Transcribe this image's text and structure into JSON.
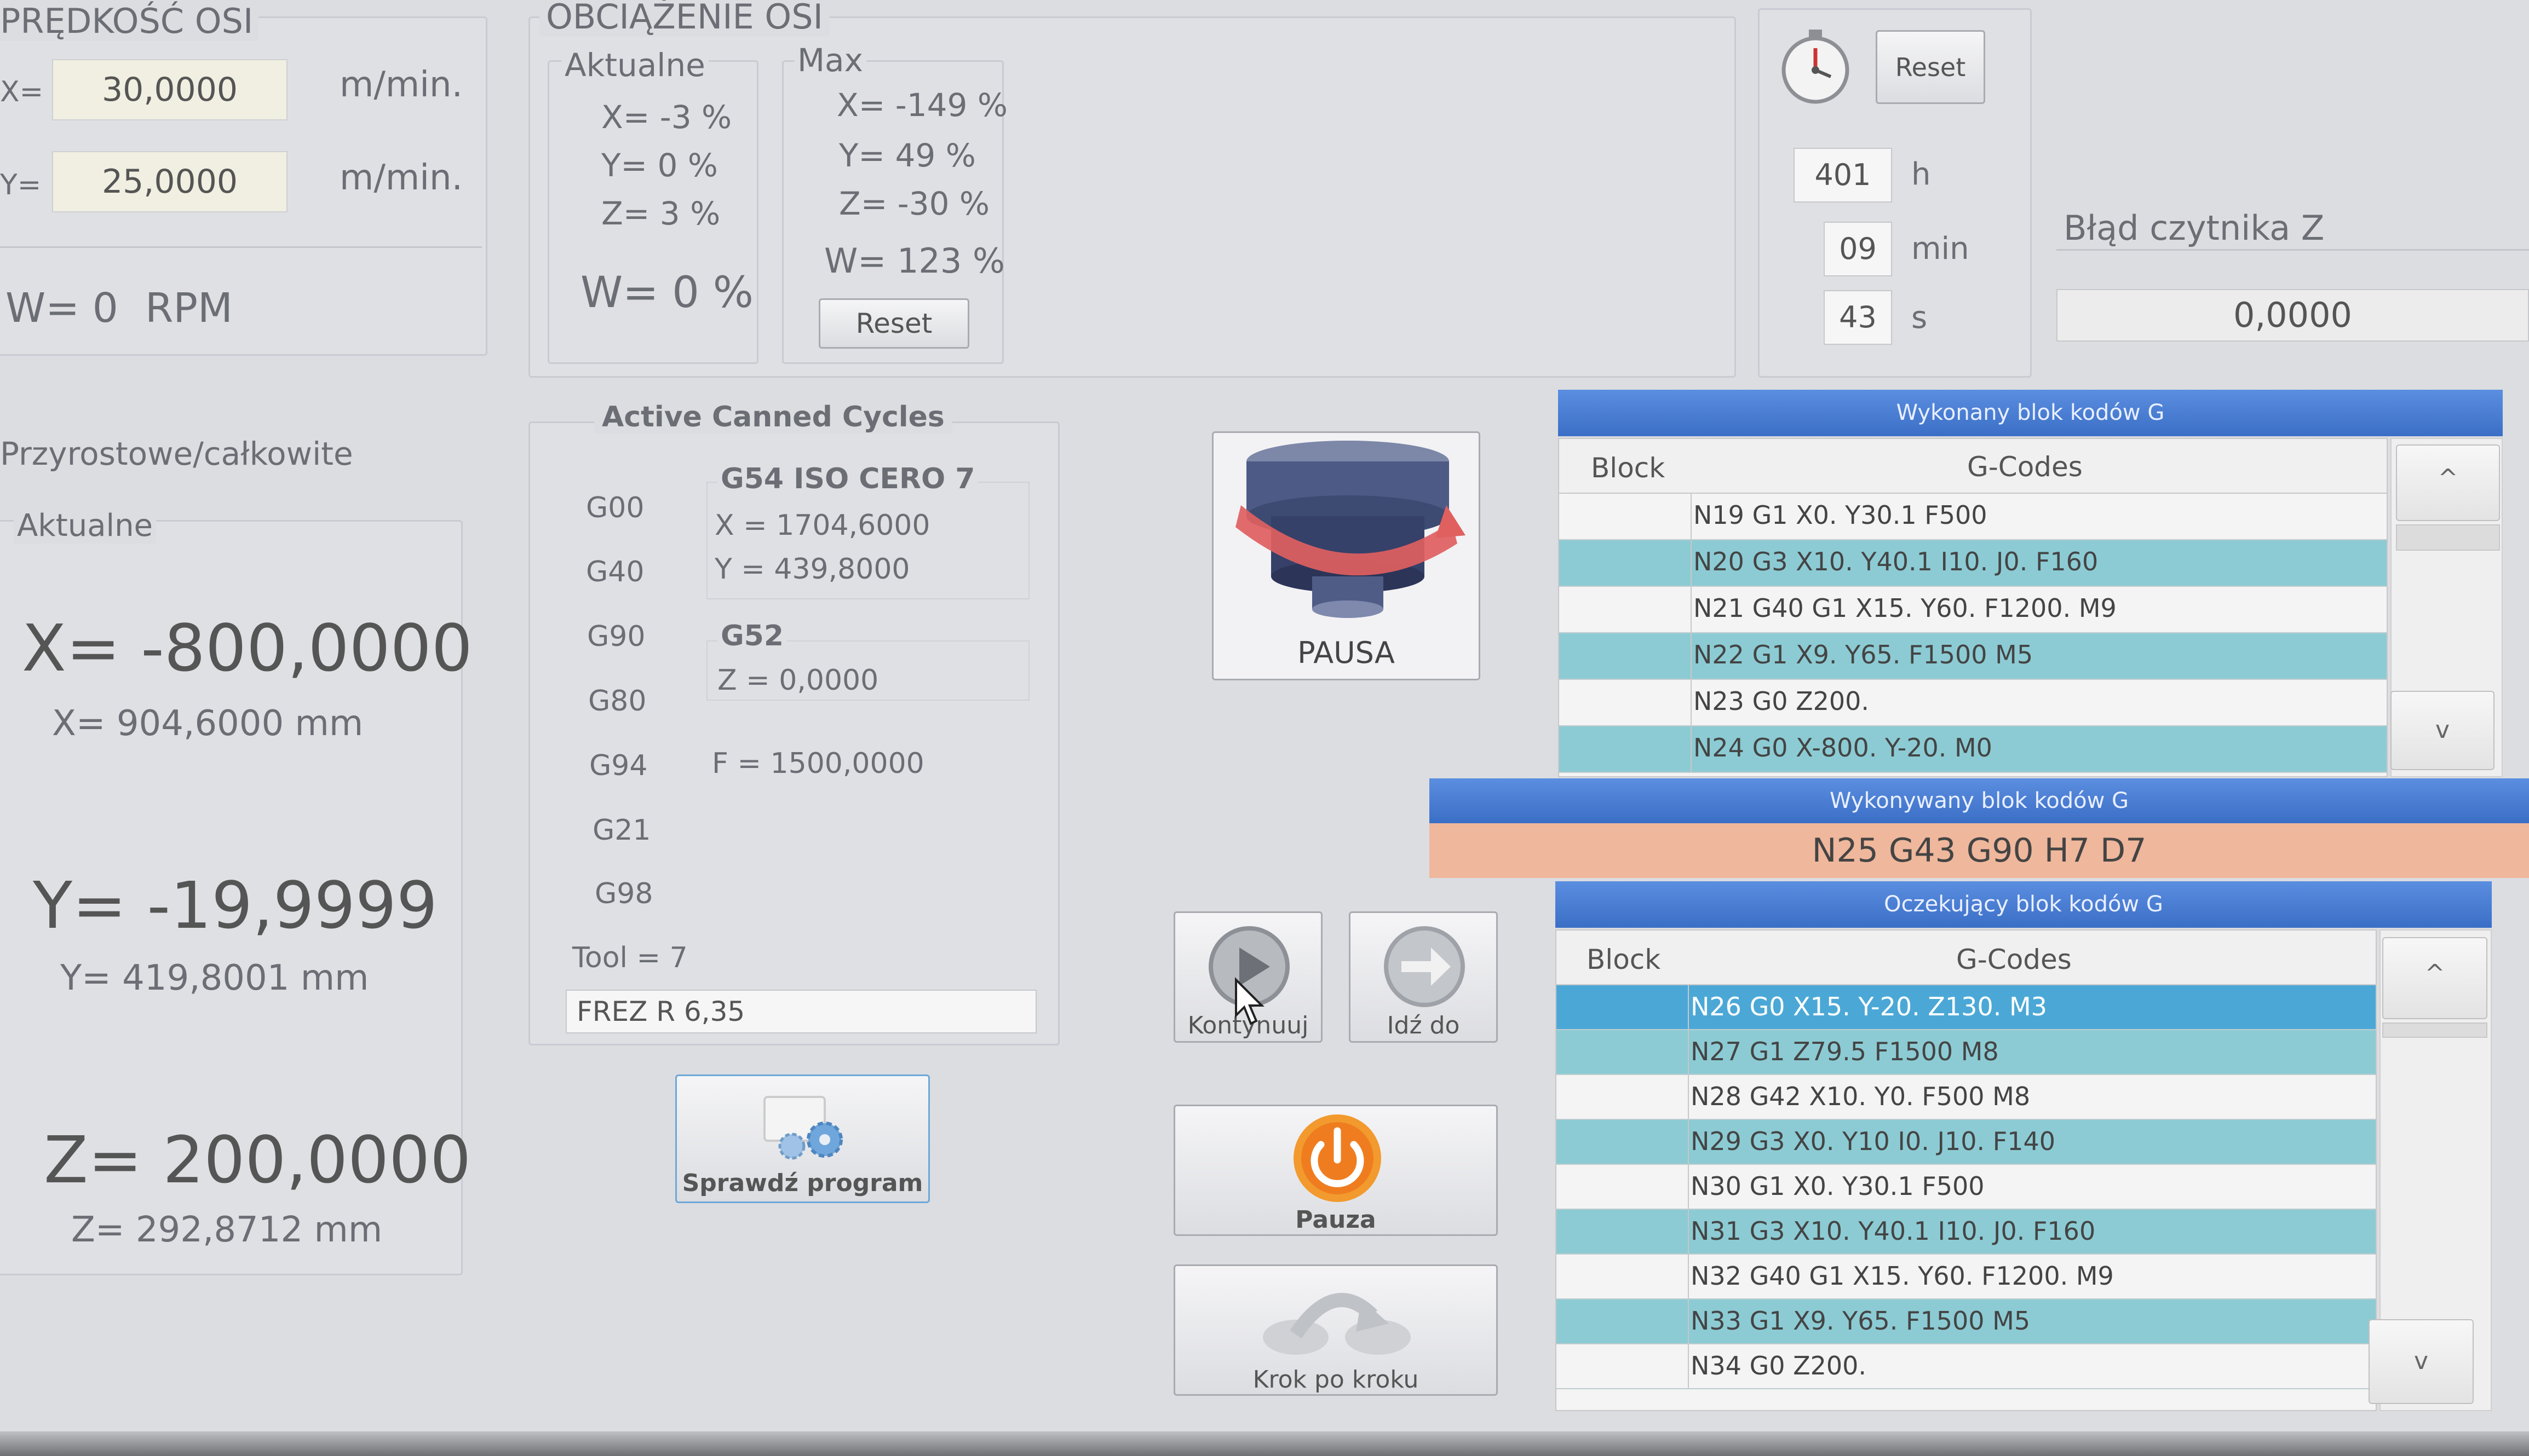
{
  "speed": {
    "title": "PRĘDKOŚĆ OSI",
    "x_label": "X=",
    "x_value": "30,0000",
    "x_unit": "m/min.",
    "y_label": "Y=",
    "y_value": "25,0000",
    "y_unit": "m/min.",
    "w_text": "W= 0",
    "w_unit": "RPM"
  },
  "load": {
    "title": "OBCIĄŻENIE OSI",
    "current_title": "Aktualne",
    "current": [
      "X= -3 %",
      "Y= 0 %",
      "Z= 3 %"
    ],
    "current_w": "W= 0 %",
    "max_title": "Max",
    "max": [
      "X= -149 %",
      "Y= 49 %",
      "Z= -30 %",
      "W= 123 %"
    ],
    "reset_label": "Reset"
  },
  "timer": {
    "reset_label": "Reset",
    "hours": "401",
    "hours_unit": "h",
    "minutes": "09",
    "minutes_unit": "min",
    "seconds": "43",
    "seconds_unit": "s"
  },
  "reader": {
    "title": "Błąd czytnika Z",
    "value": "0,0000"
  },
  "position": {
    "mode_title": "Przyrostowe/całkowite",
    "current_title": "Aktualne",
    "x_main": "X= -800,0000",
    "x_sub": "X= 904,6000 mm",
    "y_main": "Y= -19,9999",
    "y_sub": "Y= 419,8001 mm",
    "z_main": "Z= 200,0000",
    "z_sub": "Z= 292,8712 mm"
  },
  "cycles": {
    "title": "Active Canned Cycles",
    "codes": [
      "G00",
      "G40",
      "G90",
      "G80",
      "G94",
      "G21",
      "G98"
    ],
    "g54_title": "G54 ISO CERO 7",
    "g54_x": "X = 1704,6000",
    "g54_y": "Y = 439,8000",
    "g52_title": "G52",
    "g52_z": "Z = 0,0000",
    "feed": "F = 1500,0000",
    "tool": "Tool = 7",
    "tool_name": "FREZ R 6,35"
  },
  "controls": {
    "pause_big_label": "PAUSA",
    "continue_label": "Kontynuuj",
    "goto_label": "Idź do",
    "pause_label": "Pauza",
    "step_label": "Krok po kroku",
    "check_label": "Sprawdź program"
  },
  "executed": {
    "title": "Wykonany blok kodów G",
    "col_block": "Block",
    "col_codes": "G-Codes",
    "rows": [
      "N19 G1 X0. Y30.1 F500",
      "N20 G3 X10. Y40.1 I10. J0. F160",
      "N21 G40 G1 X15. Y60. F1200. M9",
      "N22 G1 X9. Y65. F1500 M5",
      "N23 G0 Z200.",
      "N24 G0 X-800. Y-20. M0"
    ],
    "up_label": "^",
    "down_label": "v"
  },
  "current_block": {
    "title": "Wykonywany blok kodów G",
    "code": "N25 G43 G90 H7 D7"
  },
  "pending": {
    "title": "Oczekujący blok kodów G",
    "col_block": "Block",
    "col_codes": "G-Codes",
    "rows": [
      "N26 G0 X15. Y-20. Z130. M3",
      "N27 G1 Z79.5 F1500 M8",
      "N28 G42 X10. Y0. F500 M8",
      "N29 G3 X0. Y10 I0. J10. F140",
      "N30 G1 X0. Y30.1 F500",
      "N31 G3 X10. Y40.1 I10. J0. F160",
      "N32 G40 G1 X15. Y60. F1200. M9",
      "N33 G1 X9. Y65. F1500 M5",
      "N34 G0 Z200."
    ],
    "up_label": "^",
    "down_label": "v"
  }
}
